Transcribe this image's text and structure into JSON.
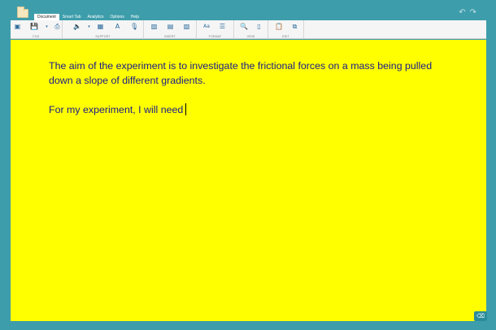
{
  "app": {
    "folder_icon": "folder-icon"
  },
  "menu": {
    "tabs": [
      {
        "label": "Document",
        "active": true
      },
      {
        "label": "Smart Tab",
        "active": false
      },
      {
        "label": "Analytics",
        "active": false
      },
      {
        "label": "Options",
        "active": false
      },
      {
        "label": "Help",
        "active": false
      }
    ]
  },
  "titlebar": {
    "undo_glyph": "↶",
    "redo_glyph": "↷"
  },
  "ribbon": {
    "groups": {
      "file": {
        "label": "FILE"
      },
      "support": {
        "label": "SUPPORT"
      },
      "insert": {
        "label": "INSERT"
      },
      "format": {
        "label": "FORMAT"
      },
      "view": {
        "label": "VIEW"
      },
      "edit": {
        "label": "EDIT"
      }
    },
    "icons": {
      "file_new": "▣",
      "file_save": "💾",
      "file_dropdown": "▾",
      "file_print": "⎙",
      "support_speak": "🔈",
      "support_dropdown": "▾",
      "support_grid": "▦",
      "support_spell": "A",
      "support_mic": "🎙",
      "insert_image": "▨",
      "insert_doc": "▤",
      "insert_shape": "▧",
      "format_font": "Aa",
      "format_align": "☰",
      "view_zoom": "🔍",
      "view_page": "▯",
      "edit_paste": "📋",
      "edit_copy": "⧉"
    }
  },
  "document": {
    "background": "#ffff00",
    "text_color": "#1a1a8c",
    "paragraphs": [
      "The aim of the experiment is to investigate the frictional forces on a mass being pulled down a slope of different gradients.",
      "For my experiment, I will need"
    ]
  },
  "corner": {
    "glyph": "⌫"
  },
  "colors": {
    "frame": "#3e9dab",
    "ribbon": "#f5f5f5",
    "icon": "#2b6a9a",
    "corner_button": "#2a8c99"
  }
}
